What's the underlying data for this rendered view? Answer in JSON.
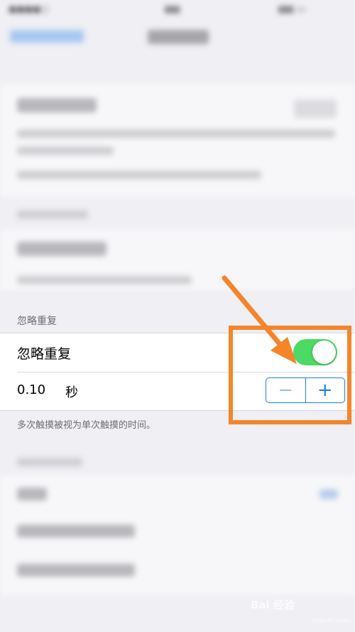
{
  "section": {
    "header": "忽略重复",
    "toggle_row": {
      "label": "忽略重复",
      "enabled": true
    },
    "duration_row": {
      "value": "0.10",
      "unit": "秒",
      "minus_symbol": "−",
      "plus_symbol": "+"
    },
    "footer": "多次触摸被视为单次触摸的时间。"
  },
  "colors": {
    "toggle_on": "#4cd964",
    "accent": "#1a7cf5",
    "annotation": "#f5852b",
    "background": "#efeff4"
  },
  "watermark": {
    "text": "Bai 经验",
    "sub": "jingyan.baidu.com"
  }
}
